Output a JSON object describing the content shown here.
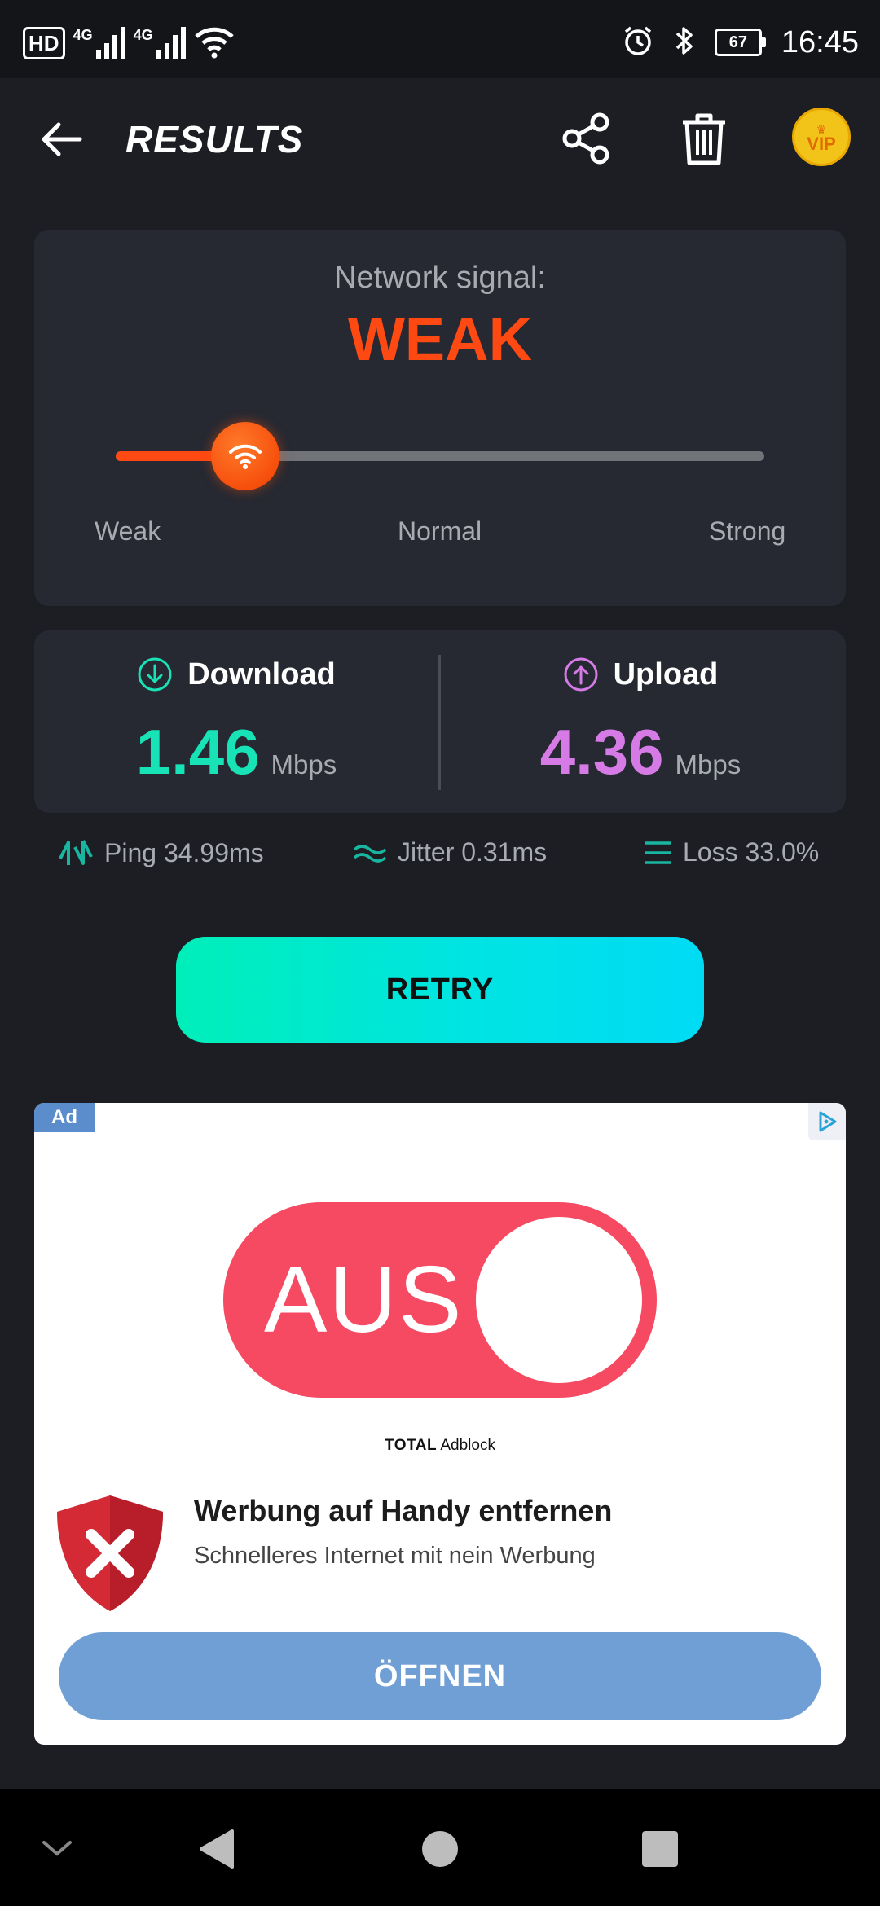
{
  "status_bar": {
    "hd_label": "HD",
    "network_1": "4G",
    "network_2": "4G",
    "battery": "67",
    "time": "16:45",
    "icons": [
      "wifi-icon",
      "alarm-icon",
      "bluetooth-icon",
      "battery-icon"
    ]
  },
  "header": {
    "title": "RESULTS",
    "vip_label": "VIP",
    "icons": [
      "back-arrow-icon",
      "share-icon",
      "trash-icon",
      "vip-crown-icon"
    ]
  },
  "signal": {
    "label": "Network signal:",
    "value": "WEAK",
    "level": 0.2,
    "scale": {
      "weak": "Weak",
      "normal": "Normal",
      "strong": "Strong"
    },
    "colors": {
      "accent": "#fe4a12",
      "track": "#717378"
    }
  },
  "speed": {
    "download": {
      "label": "Download",
      "value": "1.46",
      "unit": "Mbps",
      "color": "#17e3b7"
    },
    "upload": {
      "label": "Upload",
      "value": "4.36",
      "unit": "Mbps",
      "color": "#d67be6"
    }
  },
  "metrics": {
    "ping": "Ping 34.99ms",
    "jitter": "Jitter 0.31ms",
    "loss": "Loss 33.0%"
  },
  "retry_label": "RETRY",
  "ad": {
    "tag": "Ad",
    "toggle_text": "AUS",
    "brand_bold": "TOTAL",
    "brand_rest": "Adblock",
    "title": "Werbung auf Handy entfernen",
    "description": "Schnelleres Internet mit nein Werbung",
    "cta": "ÖFFNEN"
  }
}
